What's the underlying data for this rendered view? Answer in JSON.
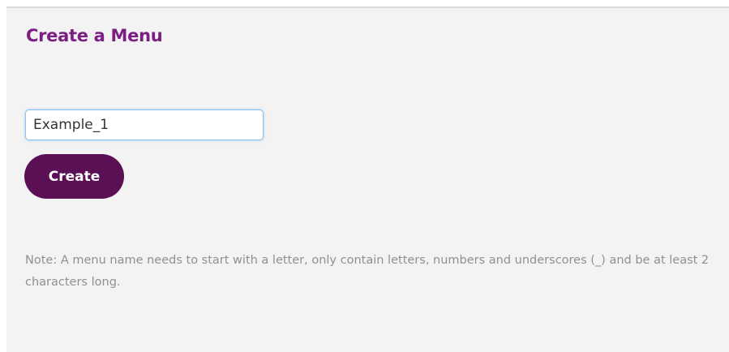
{
  "page": {
    "title": "Create a Menu"
  },
  "form": {
    "menu_name_value": "Example_1",
    "create_label": "Create"
  },
  "note": "Note: A menu name needs to start with a letter, only contain letters, numbers and underscores (_) and be at least 2 characters long.",
  "colors": {
    "title": "#7b1f82",
    "button_bg": "#5b1056",
    "panel_bg": "#f3f3f3",
    "note_text": "#909090",
    "input_focus_border": "#8cc3ee"
  }
}
